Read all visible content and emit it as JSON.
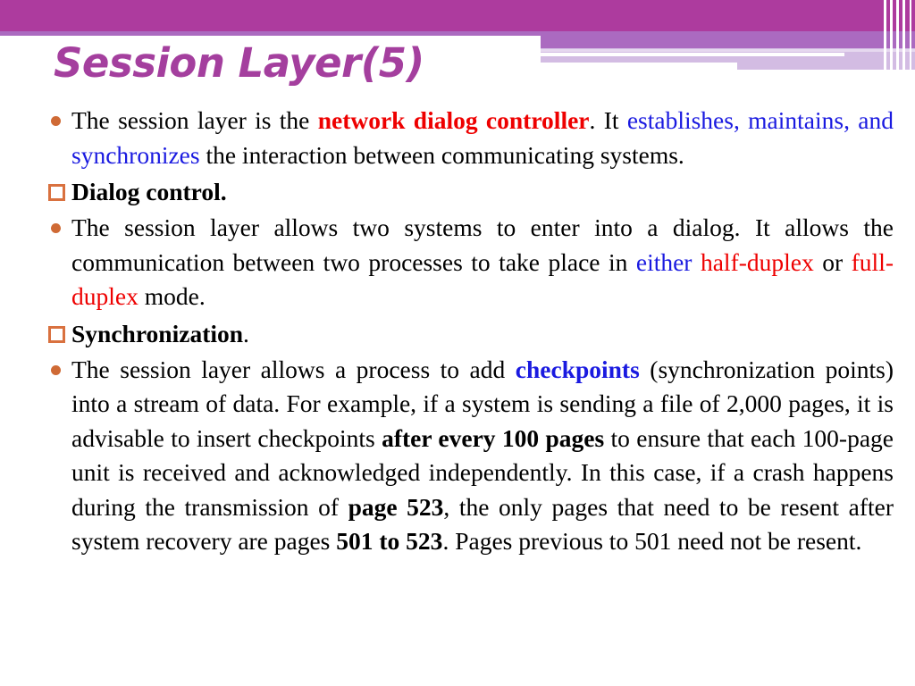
{
  "slide": {
    "title": "Session Layer(5)",
    "theme": {
      "header_purple": "#ad3b9e",
      "header_mid_purple": "#ab6ac0",
      "header_light_purple": "#d3bce3",
      "title_color": "#a43f9e",
      "bullet_dot_color": "#cf6a35",
      "bullet_square_color": "#d9713f",
      "accent_red": "#ee0000",
      "accent_blue": "#1a1ae0"
    },
    "body": {
      "p1": {
        "t1": "The session layer is the ",
        "t2": "network dialog controller",
        "t3": ". It ",
        "t4": "establishes, maintains, and synchronizes",
        "t5": " the interaction between communicating systems."
      },
      "h1": {
        "label": "Dialog control",
        "tail": "."
      },
      "p2": {
        "t1": "The session layer allows two systems to enter into a dialog. It allows the communication between two processes to take place in ",
        "t2": "either",
        "t3": " ",
        "t4": "half-duplex",
        "t5": " or ",
        "t6": "full-duplex",
        "t7": " mode."
      },
      "h2": {
        "label": "Synchronization",
        "tail": "."
      },
      "p3": {
        "t1": "The session layer allows a process to add ",
        "t2": "checkpoints",
        "t3": " (synchronization points) into a stream of data. For example, if a system is sending a file of 2,000 pages, it is advisable to insert checkpoints ",
        "t4": "after every 100 pages",
        "t5": " to ensure that each 100-page unit is received and acknowledged independently. In this case, if a crash happens during the transmission of ",
        "t6": "page 523",
        "t7": ", the only pages that need to be resent after system recovery are pages ",
        "t8": "501 to 523",
        "t9": ". Pages previous to 501 need not be resent."
      }
    }
  }
}
